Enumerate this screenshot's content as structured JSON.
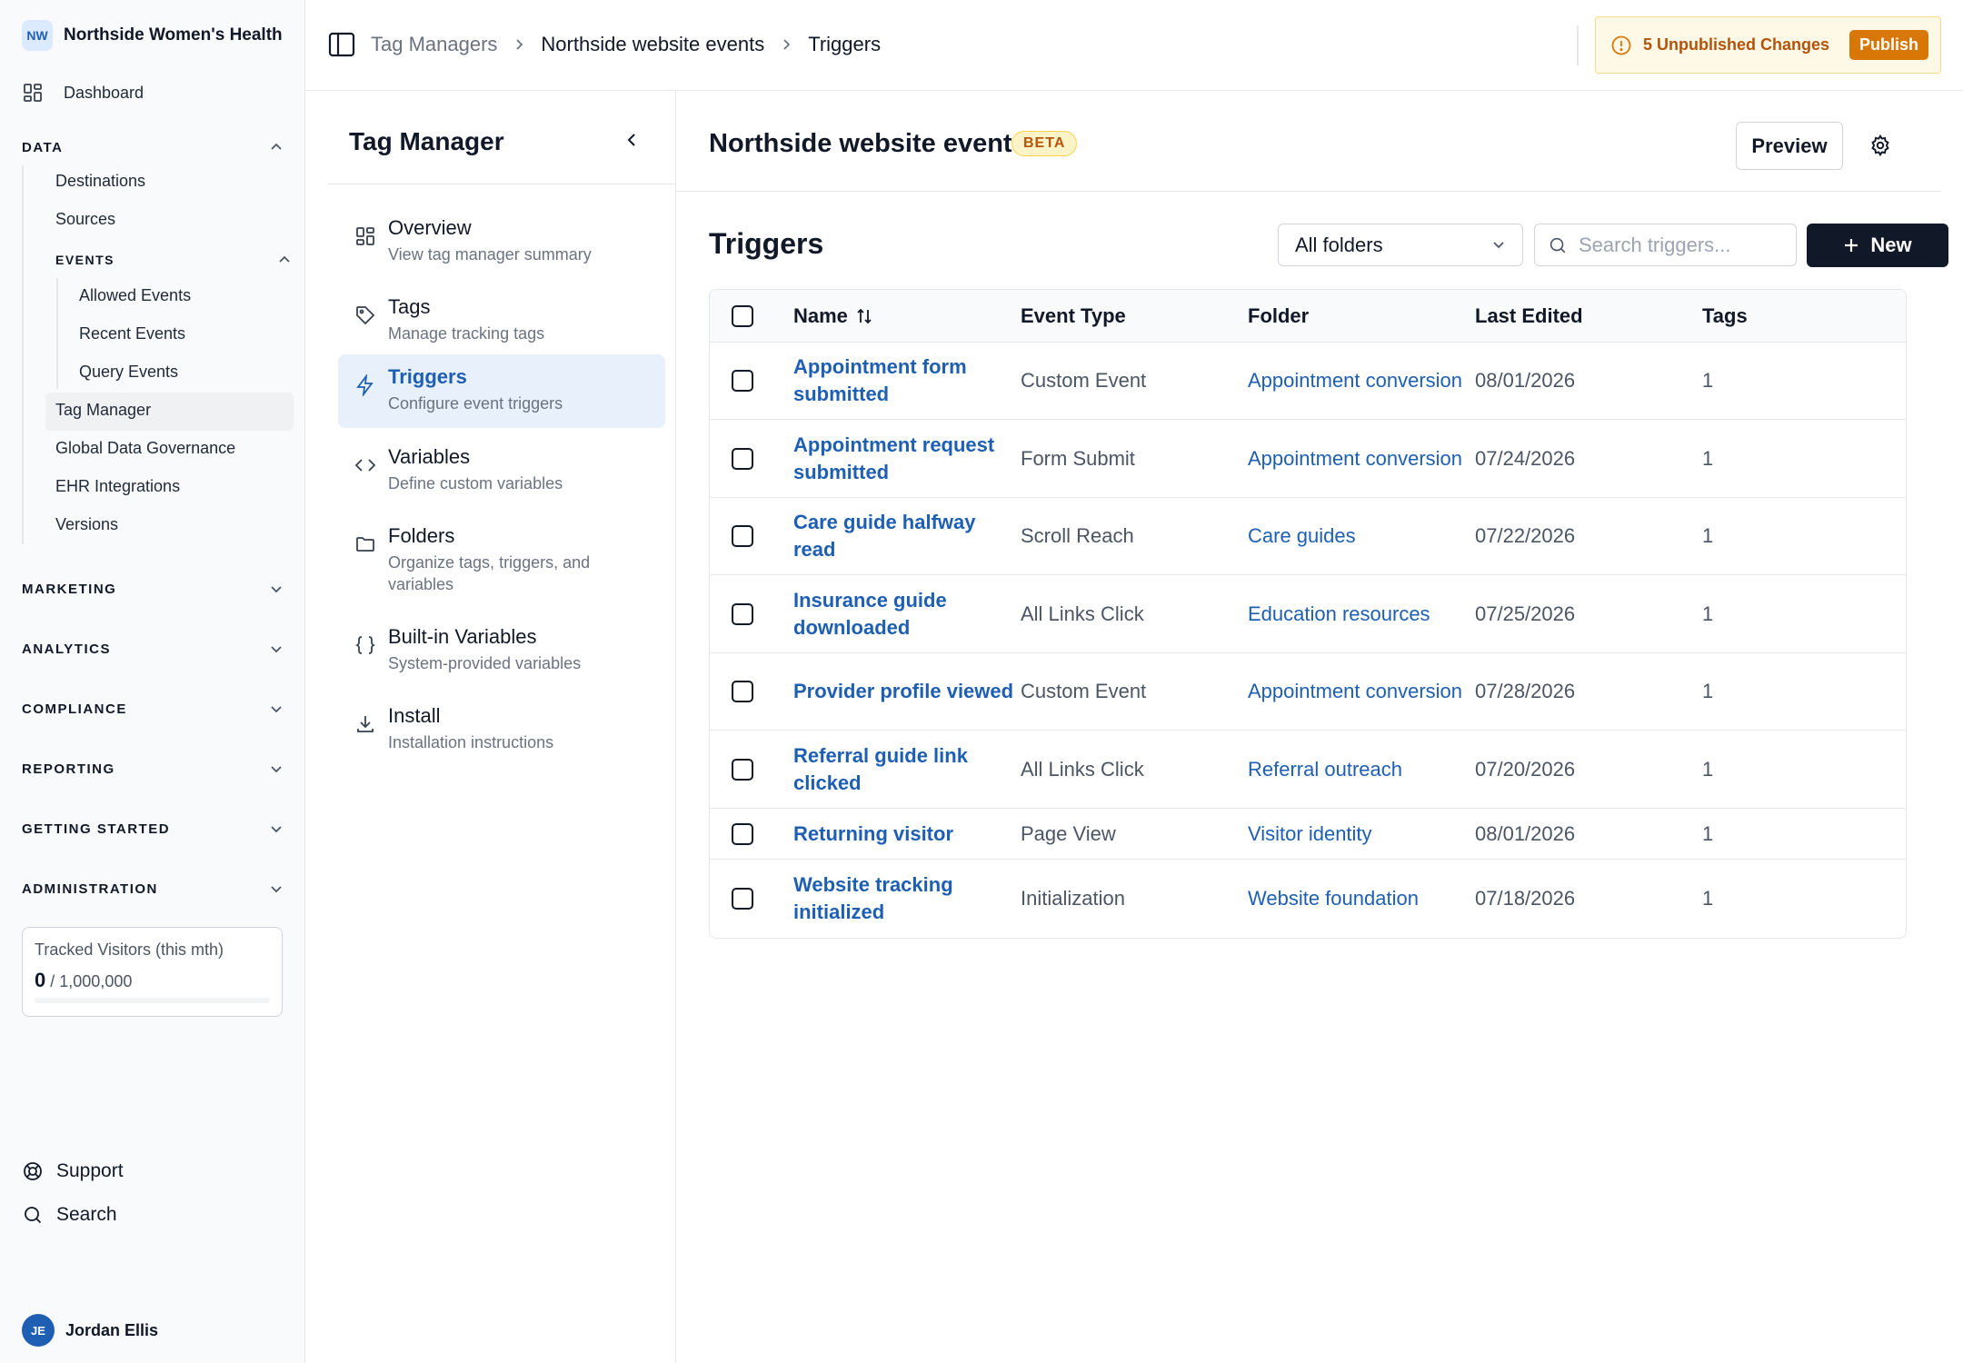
{
  "org": {
    "initials": "NW",
    "name": "Northside Women's Health"
  },
  "sidebar": {
    "dashboard": "Dashboard",
    "data_section": "DATA",
    "data_items": [
      "Destinations",
      "Sources"
    ],
    "events_section": "EVENTS",
    "events_items": [
      "Allowed Events",
      "Recent Events",
      "Query Events"
    ],
    "data_items_after": [
      "Tag Manager",
      "Global Data Governance",
      "EHR Integrations",
      "Versions"
    ],
    "active_item": "Tag Manager",
    "sections": [
      "MARKETING",
      "ANALYTICS",
      "COMPLIANCE",
      "REPORTING",
      "GETTING STARTED",
      "ADMINISTRATION"
    ],
    "usage": {
      "label": "Tracked Visitors (this mth)",
      "value": "0",
      "limit": "/ 1,000,000",
      "fraction": 0
    },
    "support": "Support",
    "search": "Search",
    "user": {
      "initials": "JE",
      "name": "Jordan Ellis"
    }
  },
  "topbar": {
    "breadcrumbs": [
      "Tag Managers",
      "Northside website events",
      "Triggers"
    ],
    "unpublished": "5 Unpublished Changes",
    "publish": "Publish"
  },
  "subnav": {
    "title": "Tag Manager",
    "items": [
      {
        "label": "Overview",
        "desc": "View tag manager summary",
        "icon": "grid-icon"
      },
      {
        "label": "Tags",
        "desc": "Manage tracking tags",
        "icon": "tag-icon"
      },
      {
        "label": "Triggers",
        "desc": "Configure event triggers",
        "icon": "bolt-icon"
      },
      {
        "label": "Variables",
        "desc": "Define custom variables",
        "icon": "code-icon"
      },
      {
        "label": "Folders",
        "desc": "Organize tags, triggers, and variables",
        "icon": "folder-icon"
      },
      {
        "label": "Built-in Variables",
        "desc": "System-provided variables",
        "icon": "braces-icon"
      },
      {
        "label": "Install",
        "desc": "Installation instructions",
        "icon": "download-icon"
      }
    ],
    "active": "Triggers"
  },
  "main": {
    "title": "Northside website events",
    "badge": "BETA",
    "preview": "Preview",
    "section_title": "Triggers",
    "folder_filter": "All folders",
    "search_placeholder": "Search triggers...",
    "new_button": "New",
    "columns": [
      "Name",
      "Event Type",
      "Folder",
      "Last Edited",
      "Tags"
    ],
    "rows": [
      {
        "name": "Appointment form submitted",
        "type": "Custom Event",
        "folder": "Appointment conversion",
        "edited": "08/01/2026",
        "tags": "1"
      },
      {
        "name": "Appointment request submitted",
        "type": "Form Submit",
        "folder": "Appointment conversion",
        "edited": "07/24/2026",
        "tags": "1"
      },
      {
        "name": "Care guide halfway read",
        "type": "Scroll Reach",
        "folder": "Care guides",
        "edited": "07/22/2026",
        "tags": "1"
      },
      {
        "name": "Insurance guide downloaded",
        "type": "All Links Click",
        "folder": "Education resources",
        "edited": "07/25/2026",
        "tags": "1"
      },
      {
        "name": "Provider profile viewed",
        "type": "Custom Event",
        "folder": "Appointment conversion",
        "edited": "07/28/2026",
        "tags": "1"
      },
      {
        "name": "Referral guide link clicked",
        "type": "All Links Click",
        "folder": "Referral outreach",
        "edited": "07/20/2026",
        "tags": "1"
      },
      {
        "name": "Returning visitor",
        "type": "Page View",
        "folder": "Visitor identity",
        "edited": "08/01/2026",
        "tags": "1"
      },
      {
        "name": "Website tracking initialized",
        "type": "Initialization",
        "folder": "Website foundation",
        "edited": "07/18/2026",
        "tags": "1"
      }
    ]
  },
  "colors": {
    "accent": "#1e5fb3",
    "warning": "#d97706",
    "warning_bg": "#fef9e7",
    "dark_button": "#111827"
  }
}
